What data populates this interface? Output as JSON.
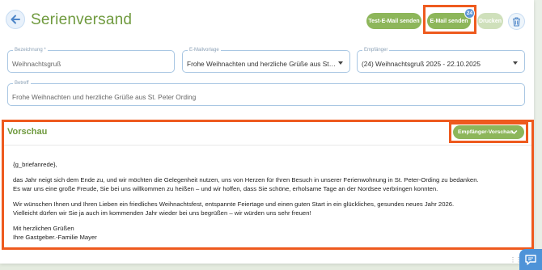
{
  "header": {
    "title": "Serienversand",
    "test_email_label": "Test-E-Mail senden",
    "send_email_label": "E-Mail senden",
    "send_badge": "24",
    "print_label": "Drucken"
  },
  "form": {
    "bezeichnung": {
      "label": "Bezeichnung *",
      "value": "Weihnachtsgruß"
    },
    "vorlage": {
      "label": "E-Mailvorlage",
      "value": "Frohe Weihnachten und herzliche Grüße aus St. Peter-Ording"
    },
    "empfaenger": {
      "label": "Empfänger",
      "value": "(24) Weihnachtsgruß 2025 - 22.10.2025"
    },
    "betreff": {
      "label": "Betreff",
      "value": "Frohe Weihnachten und herzliche Grüße aus St. Peter Ording"
    }
  },
  "preview": {
    "title": "Vorschau",
    "recipient_preview_label": "Empfänger-Vorschau",
    "greeting": "{g_briefanrede},",
    "lines": [
      "das Jahr neigt sich dem Ende zu, und wir möchten die Gelegenheit nutzen, uns von Herzen für Ihren Besuch in unserer Ferienwohnung in St. Peter-Ording zu bedanken.",
      "Es war uns eine große Freude, Sie bei uns willkommen zu heißen – und wir hoffen, dass Sie schöne, erholsame Tage an der Nordsee verbringen konnten.",
      "Wir wünschen Ihnen und Ihren Lieben ein friedliches Weihnachtsfest, entspannte Feiertage und einen guten Start in ein glückliches, gesundes neues Jahr 2026.",
      "Vielleicht dürfen wir Sie ja auch im kommenden Jahr wieder bei uns begrüßen – wir würden uns sehr freuen!",
      "Mit herzlichen Grüßen",
      "Ihre Gastgeber.-Familie Mayer"
    ]
  },
  "colors": {
    "accent_green": "#8db65a",
    "title_green": "#6f9a3e",
    "highlight_orange": "#ee5a1e",
    "badge_blue": "#5f96d6"
  },
  "icons": {
    "back": "arrow-left-icon",
    "delete": "trash-icon",
    "dropdown": "chevron-down-icon",
    "chat": "chat-icon",
    "resize": "grip-icon"
  }
}
